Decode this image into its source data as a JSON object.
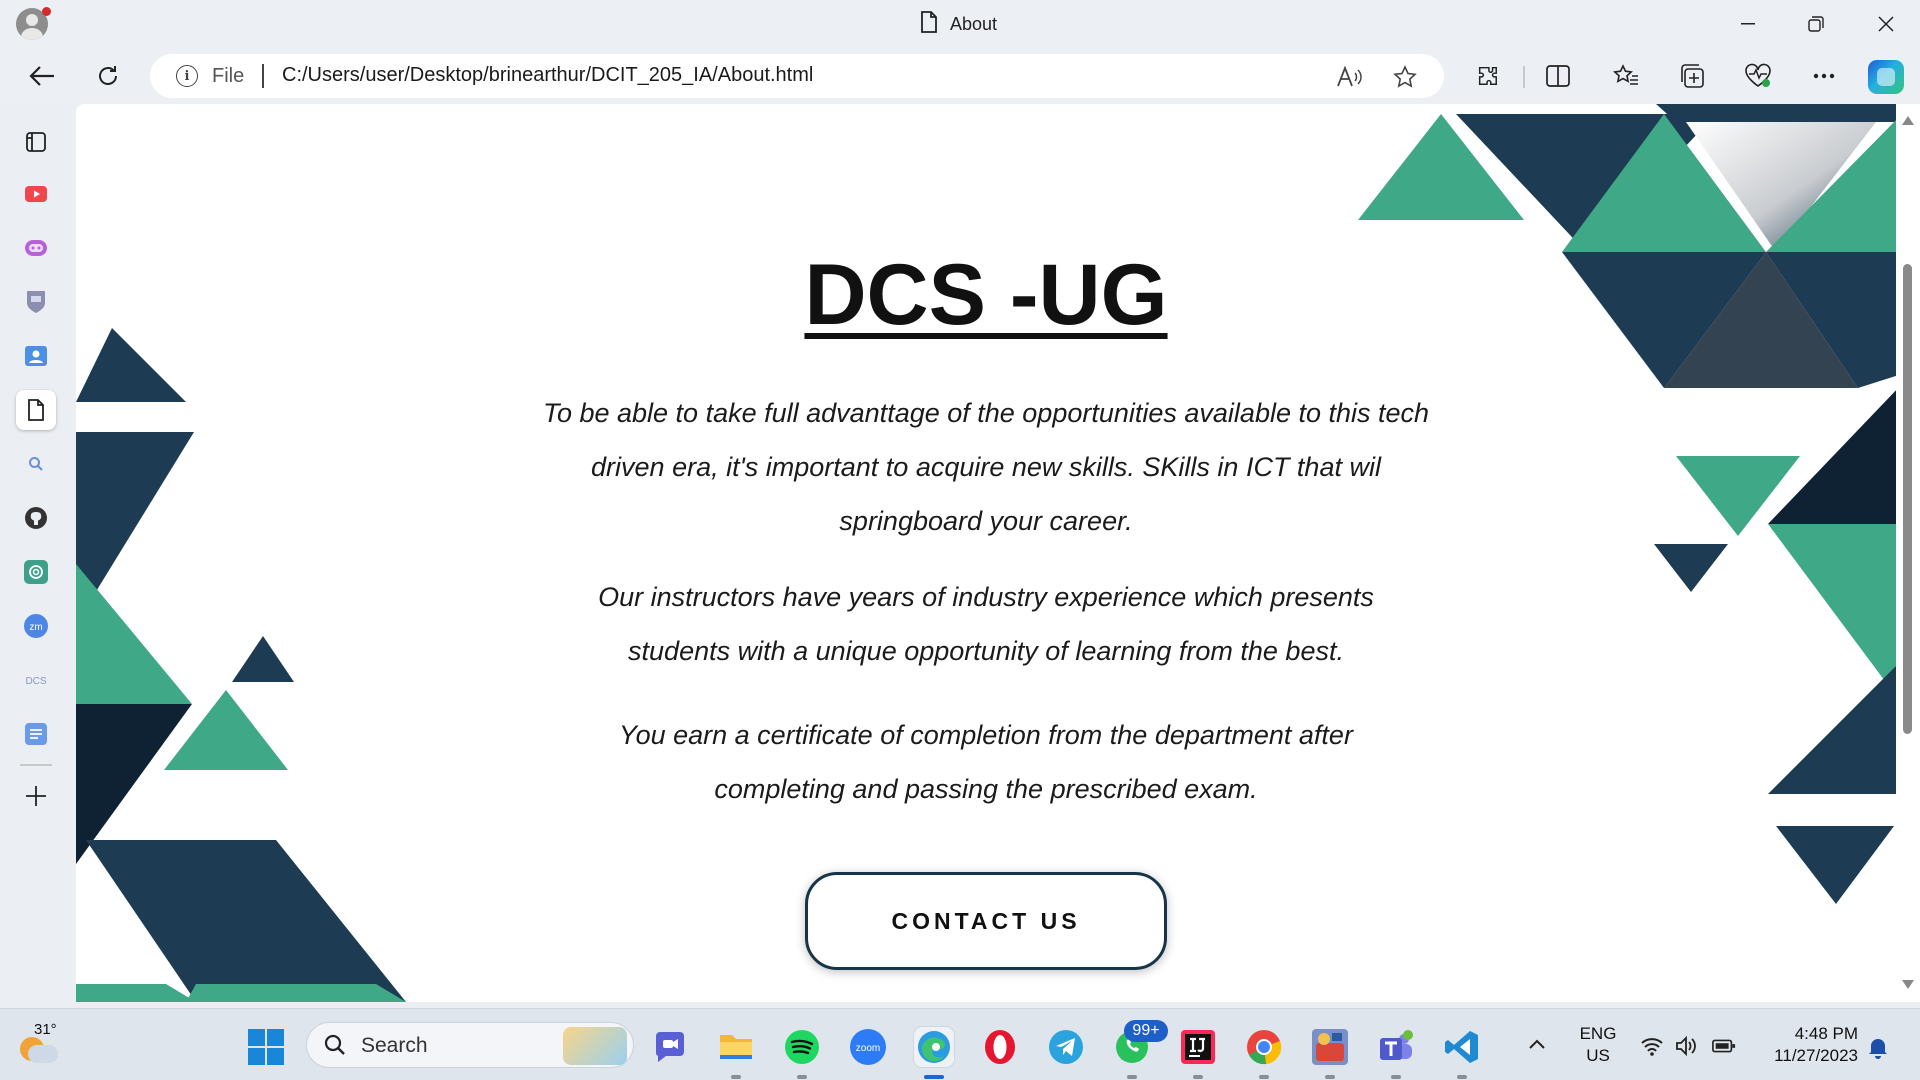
{
  "browser": {
    "tab_title": "About",
    "address": {
      "scheme_label": "File",
      "url": "C:/Users/user/Desktop/brinearthur/DCIT_205_IA/About.html"
    }
  },
  "page": {
    "heading": "DCS -UG",
    "paragraphs": [
      "To be able to take full advanttage of the opportunities available to this tech driven era, it's important to acquire new skills. SKills in ICT that wil springboard your career.",
      "Our instructors have years of industry experience which presents students with a unique opportunity of learning from the best.",
      "You earn a certificate of completion from the department after completing and passing the prescribed exam."
    ],
    "contact_button": "CONTACT US",
    "colors": {
      "navy": "#1d3c53",
      "dark": "#0f2233",
      "green": "#3fa886"
    }
  },
  "sidebar": {
    "dcs_label": "DCS",
    "zoom_label": "zm"
  },
  "taskbar": {
    "weather_temp": "31°",
    "search_label": "Search",
    "whatsapp_badge": "99+",
    "zoom_label": "zoom",
    "lang_line1": "ENG",
    "lang_line2": "US",
    "time": "4:48 PM",
    "date": "11/27/2023"
  }
}
